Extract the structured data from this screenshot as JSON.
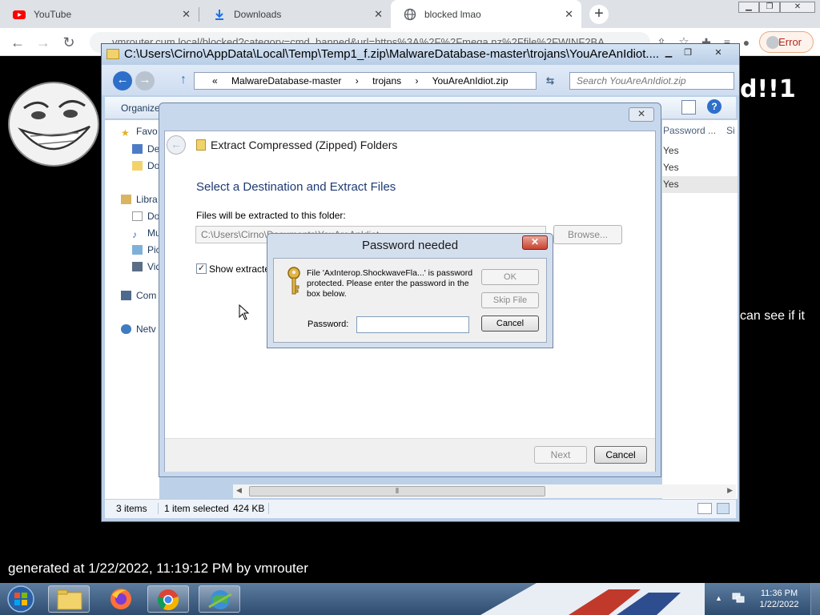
{
  "browser": {
    "tabs": [
      {
        "label": "YouTube",
        "icon": "youtube-icon"
      },
      {
        "label": "Downloads",
        "icon": "download-icon"
      },
      {
        "label": "blocked lmao",
        "icon": "globe-icon",
        "active": true
      }
    ],
    "url": "vmrouter.cum.local/blocked?category=cmd_banned&url=https%3A%2F%2Fmega.nz%2Ffile%2FWINF2BA",
    "error_label": "Error"
  },
  "page": {
    "heading_fragment": "d!!1",
    "side_text": "can see if it",
    "footer": "generated at 1/22/2022, 11:19:12 PM by vmrouter"
  },
  "explorer": {
    "title": "C:\\Users\\Cirno\\AppData\\Local\\Temp\\Temp1_f.zip\\MalwareDatabase-master\\trojans\\YouAreAnIdiot....",
    "breadcrumb": [
      "«",
      "MalwareDatabase-master",
      "›",
      "trojans",
      "›",
      "YouAreAnIdiot.zip"
    ],
    "search_placeholder": "Search YouAreAnIdiot.zip",
    "organize": "Organize",
    "nav_items": [
      "Favo",
      "De",
      "Do",
      "Libra",
      "Do",
      "Mu",
      "Pic",
      "Vid",
      "Com",
      "Netv"
    ],
    "columns": [
      "Password ...",
      "Si"
    ],
    "password_values": [
      "Yes",
      "Yes",
      "Yes"
    ],
    "status": {
      "count": "3 items",
      "selected": "1 item selected",
      "size": "424 KB"
    }
  },
  "extract": {
    "title": "Extract Compressed (Zipped) Folders",
    "heading": "Select a Destination and Extract Files",
    "folder_label": "Files will be extracted to this folder:",
    "folder_path": "C:\\Users\\Cirno\\Documents\\YouAreAnIdiot",
    "browse": "Browse...",
    "show_label": "Show extracte",
    "show_checked": "✓",
    "next": "Next",
    "cancel": "Cancel"
  },
  "password_dialog": {
    "title": "Password needed",
    "message": "File 'AxInterop.ShockwaveFla...' is password protected.  Please enter the password in the box below.",
    "ok": "OK",
    "skip": "Skip File",
    "cancel": "Cancel",
    "field_label": "Password:",
    "value": ""
  },
  "taskbar": {
    "time": "11:36 PM",
    "date": "1/22/2022"
  }
}
